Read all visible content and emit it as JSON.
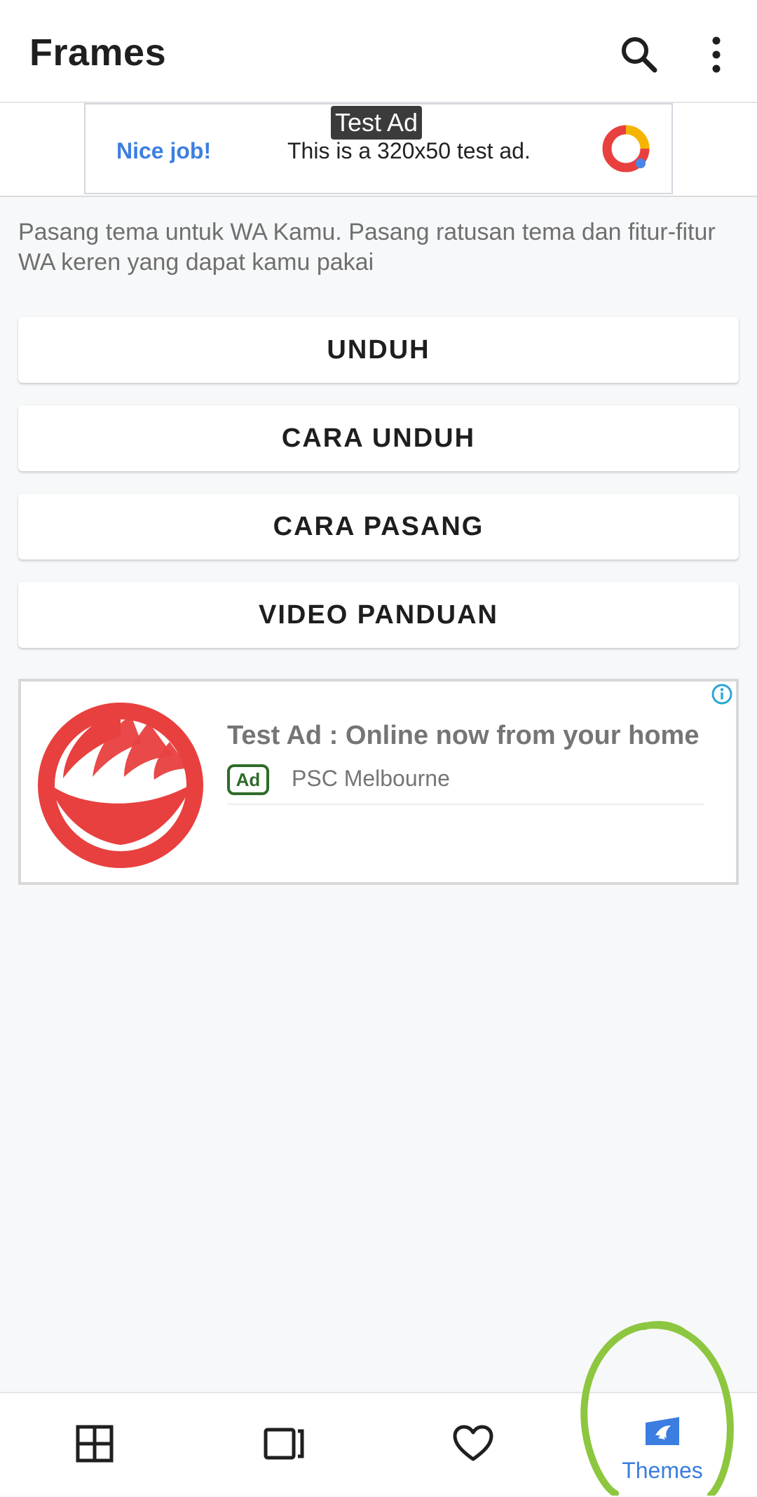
{
  "app_bar": {
    "title": "Frames",
    "icons": [
      "search-icon",
      "more-vert-icon"
    ]
  },
  "banner_ad": {
    "tag": "Test Ad",
    "headline": "Nice job!",
    "message": "This is a 320x50 test ad.",
    "logo": "ad-logo-icon"
  },
  "description": "Pasang tema untuk WA Kamu. Pasang ratusan tema dan fitur-fitur WA keren yang dapat kamu pakai",
  "buttons": [
    {
      "label": "UNDUH"
    },
    {
      "label": "CARA UNDUH"
    },
    {
      "label": "CARA PASANG"
    },
    {
      "label": "VIDEO PANDUAN"
    }
  ],
  "native_ad": {
    "headline": "Test Ad : Online now from your home",
    "badge": "Ad",
    "advertiser": "PSC Melbourne",
    "logo": "advertiser-logo",
    "info_icon": "info-icon"
  },
  "bottom_nav": {
    "items": [
      {
        "icon": "grid-icon",
        "label": ""
      },
      {
        "icon": "frame-icon",
        "label": ""
      },
      {
        "icon": "heart-icon",
        "label": ""
      },
      {
        "icon": "themes-icon",
        "label": "Themes",
        "active": true
      }
    ]
  },
  "colors": {
    "accent": "#3b7de0",
    "ad_green": "#2f6b2a",
    "logo_red": "#e8403f",
    "annotation": "#8dc63f"
  }
}
